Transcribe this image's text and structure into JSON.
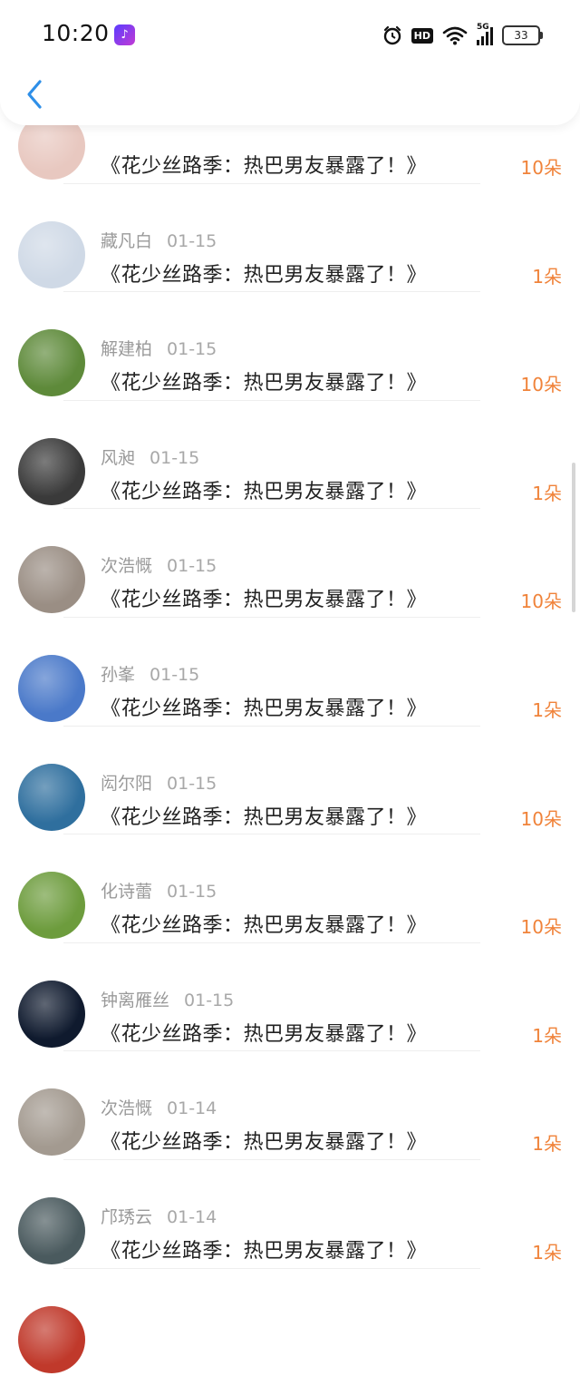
{
  "status_bar": {
    "time": "10:20",
    "app_icon": "music-app-icon",
    "signal_label": "5G",
    "hd_label": "HD",
    "battery": "33"
  },
  "nav": {
    "back_icon": "chevron-left-icon"
  },
  "records": [
    {
      "name": "",
      "date": "",
      "title": "《花少丝路季：热巴男友暴露了！》",
      "amount": "10朵",
      "avatar_color": "#e8c8c0"
    },
    {
      "name": "藏凡白",
      "date": "01-15",
      "title": "《花少丝路季：热巴男友暴露了！》",
      "amount": "1朵",
      "avatar_color": "#cfd9e6"
    },
    {
      "name": "解建柏",
      "date": "01-15",
      "title": "《花少丝路季：热巴男友暴露了！》",
      "amount": "10朵",
      "avatar_color": "#5e8a3a"
    },
    {
      "name": "风昶",
      "date": "01-15",
      "title": "《花少丝路季：热巴男友暴露了！》",
      "amount": "1朵",
      "avatar_color": "#3a3a3a"
    },
    {
      "name": "次浩慨",
      "date": "01-15",
      "title": "《花少丝路季：热巴男友暴露了！》",
      "amount": "10朵",
      "avatar_color": "#9a8e84"
    },
    {
      "name": "孙峯",
      "date": "01-15",
      "title": "《花少丝路季：热巴男友暴露了！》",
      "amount": "1朵",
      "avatar_color": "#4a79c9"
    },
    {
      "name": "闳尔阳",
      "date": "01-15",
      "title": "《花少丝路季：热巴男友暴露了！》",
      "amount": "10朵",
      "avatar_color": "#2f6f9e"
    },
    {
      "name": "化诗蕾",
      "date": "01-15",
      "title": "《花少丝路季：热巴男友暴露了！》",
      "amount": "10朵",
      "avatar_color": "#6d9c3d"
    },
    {
      "name": "钟离雁丝",
      "date": "01-15",
      "title": "《花少丝路季：热巴男友暴露了！》",
      "amount": "1朵",
      "avatar_color": "#0f1a2e"
    },
    {
      "name": "次浩慨",
      "date": "01-14",
      "title": "《花少丝路季：热巴男友暴露了！》",
      "amount": "1朵",
      "avatar_color": "#a39a90"
    },
    {
      "name": "邝琇云",
      "date": "01-14",
      "title": "《花少丝路季：热巴男友暴露了！》",
      "amount": "1朵",
      "avatar_color": "#4a5a5e"
    },
    {
      "name": "",
      "date": "",
      "title": "",
      "amount": "",
      "avatar_color": "#c0392b"
    }
  ]
}
